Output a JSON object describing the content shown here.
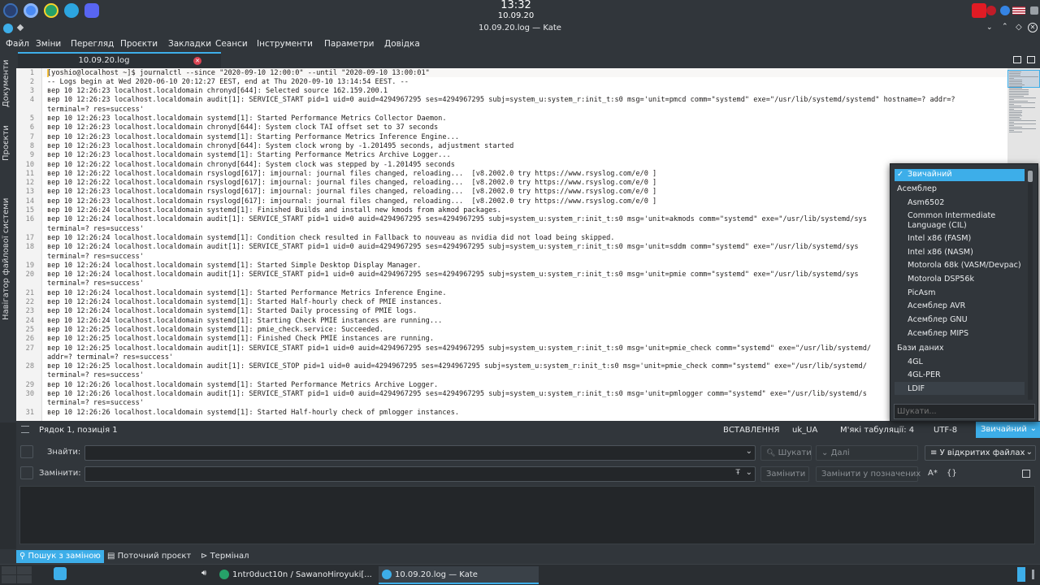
{
  "top_panel": {
    "time": "13:32",
    "date": "10.09.20",
    "launchers": [
      "fedora-icon",
      "chromium-icon",
      "app-icon",
      "telegram-icon",
      "discord-icon"
    ]
  },
  "window": {
    "title": "10.09.20.log — Kate"
  },
  "menu": [
    "Файл",
    "Зміни",
    "Перегляд",
    "Проєкти",
    "Закладки",
    "Сеанси",
    "Інструменти",
    "Параметри",
    "Довідка"
  ],
  "side_tabs": [
    "Документи",
    "Проєкти",
    "Навігатор файлової системи"
  ],
  "tab": {
    "label": "10.09.20.log"
  },
  "editor": {
    "line_numbers": [
      "1",
      "2",
      "3",
      "4",
      "",
      "5",
      "6",
      "7",
      "8",
      "9",
      "10",
      "11",
      "12",
      "13",
      "14",
      "15",
      "16",
      "",
      "17",
      "18",
      "",
      "19",
      "20",
      "",
      "21",
      "22",
      "23",
      "24",
      "25",
      "26",
      "27",
      "",
      "28",
      "",
      "29",
      "30",
      "",
      "31"
    ],
    "lines": [
      "[yoshio@localhost ~]$ journalctl --since \"2020-09-10 12:00:0\" --until \"2020-09-10 13:00:01\"",
      "-- Logs begin at Wed 2020-06-10 20:12:27 EEST, end at Thu 2020-09-10 13:14:54 EEST. --",
      "вер 10 12:26:23 localhost.localdomain chronyd[644]: Selected source 162.159.200.1",
      "вер 10 12:26:23 localhost.localdomain audit[1]: SERVICE_START pid=1 uid=0 auid=4294967295 ses=4294967295 subj=system_u:system_r:init_t:s0 msg='unit=pmcd comm=\"systemd\" exe=\"/usr/lib/systemd/systemd\" hostname=? addr=?",
      "terminal=? res=success'",
      "вер 10 12:26:23 localhost.localdomain systemd[1]: Started Performance Metrics Collector Daemon.",
      "вер 10 12:26:23 localhost.localdomain chronyd[644]: System clock TAI offset set to 37 seconds",
      "вер 10 12:26:23 localhost.localdomain systemd[1]: Starting Performance Metrics Inference Engine...",
      "вер 10 12:26:23 localhost.localdomain chronyd[644]: System clock wrong by -1.201495 seconds, adjustment started",
      "вер 10 12:26:23 localhost.localdomain systemd[1]: Starting Performance Metrics Archive Logger...",
      "вер 10 12:26:22 localhost.localdomain chronyd[644]: System clock was stepped by -1.201495 seconds",
      "вер 10 12:26:22 localhost.localdomain rsyslogd[617]: imjournal: journal files changed, reloading...  [v8.2002.0 try https://www.rsyslog.com/e/0 ]",
      "вер 10 12:26:22 localhost.localdomain rsyslogd[617]: imjournal: journal files changed, reloading...  [v8.2002.0 try https://www.rsyslog.com/e/0 ]",
      "вер 10 12:26:23 localhost.localdomain rsyslogd[617]: imjournal: journal files changed, reloading...  [v8.2002.0 try https://www.rsyslog.com/e/0 ]",
      "вер 10 12:26:23 localhost.localdomain rsyslogd[617]: imjournal: journal files changed, reloading...  [v8.2002.0 try https://www.rsyslog.com/e/0 ]",
      "вер 10 12:26:24 localhost.localdomain systemd[1]: Finished Builds and install new kmods from akmod packages.",
      "вер 10 12:26:24 localhost.localdomain audit[1]: SERVICE_START pid=1 uid=0 auid=4294967295 ses=4294967295 subj=system_u:system_r:init_t:s0 msg='unit=akmods comm=\"systemd\" exe=\"/usr/lib/systemd/sys",
      "terminal=? res=success'",
      "вер 10 12:26:24 localhost.localdomain systemd[1]: Condition check resulted in Fallback to nouveau as nvidia did not load being skipped.",
      "вер 10 12:26:24 localhost.localdomain audit[1]: SERVICE_START pid=1 uid=0 auid=4294967295 ses=4294967295 subj=system_u:system_r:init_t:s0 msg='unit=sddm comm=\"systemd\" exe=\"/usr/lib/systemd/sys",
      "terminal=? res=success'",
      "вер 10 12:26:24 localhost.localdomain systemd[1]: Started Simple Desktop Display Manager.",
      "вер 10 12:26:24 localhost.localdomain audit[1]: SERVICE_START pid=1 uid=0 auid=4294967295 ses=4294967295 subj=system_u:system_r:init_t:s0 msg='unit=pmie comm=\"systemd\" exe=\"/usr/lib/systemd/sys",
      "terminal=? res=success'",
      "вер 10 12:26:24 localhost.localdomain systemd[1]: Started Performance Metrics Inference Engine.",
      "вер 10 12:26:24 localhost.localdomain systemd[1]: Started Half-hourly check of PMIE instances.",
      "вер 10 12:26:24 localhost.localdomain systemd[1]: Started Daily processing of PMIE logs.",
      "вер 10 12:26:24 localhost.localdomain systemd[1]: Starting Check PMIE instances are running...",
      "вер 10 12:26:25 localhost.localdomain systemd[1]: pmie_check.service: Succeeded.",
      "вер 10 12:26:25 localhost.localdomain systemd[1]: Finished Check PMIE instances are running.",
      "вер 10 12:26:25 localhost.localdomain audit[1]: SERVICE_START pid=1 uid=0 auid=4294967295 ses=4294967295 subj=system_u:system_r:init_t:s0 msg='unit=pmie_check comm=\"systemd\" exe=\"/usr/lib/systemd/",
      "addr=? terminal=? res=success'",
      "вер 10 12:26:25 localhost.localdomain audit[1]: SERVICE_STOP pid=1 uid=0 auid=4294967295 ses=4294967295 subj=system_u:system_r:init_t:s0 msg='unit=pmie_check comm=\"systemd\" exe=\"/usr/lib/systemd/",
      "terminal=? res=success'",
      "вер 10 12:26:26 localhost.localdomain systemd[1]: Started Performance Metrics Archive Logger.",
      "вер 10 12:26:26 localhost.localdomain audit[1]: SERVICE_START pid=1 uid=0 auid=4294967295 ses=4294967295 subj=system_u:system_r:init_t:s0 msg='unit=pmlogger comm=\"systemd\" exe=\"/usr/lib/systemd/s",
      "terminal=? res=success'",
      "вер 10 12:26:26 localhost.localdomain systemd[1]: Started Half-hourly check of pmlogger instances."
    ]
  },
  "status_bar": {
    "position": "Рядок 1, позиція 1",
    "insert_mode": "ВСТАВЛЕННЯ",
    "dictionary": "uk_UA",
    "indentation": "М'які табуляції: 4",
    "encoding": "UTF-8",
    "mode": "Звичайний"
  },
  "mode_popup": {
    "selected": "Звичайний",
    "groups": [
      {
        "header": "Асемблер",
        "items": [
          "Asm6502",
          "Common Intermediate",
          "Language (CIL)",
          "Intel x86 (FASM)",
          "Intel x86 (NASM)",
          "Motorola 68k (VASM/Devpac)",
          "Motorola DSP56k",
          "PicAsm",
          "Асемблер AVR",
          "Асемблер GNU",
          "Асемблер MIPS"
        ]
      },
      {
        "header": "Бази даних",
        "items": [
          "4GL",
          "4GL-PER",
          "LDIF"
        ]
      }
    ],
    "search_placeholder": "Шукати..."
  },
  "search_panel": {
    "find_label": "Знайти:",
    "replace_label": "Замінити:",
    "find_value": "",
    "replace_value": "",
    "search_button": "Шукати",
    "next_button": "Далі",
    "scope": "У відкритих файлах",
    "replace_button": "Замінити",
    "replace_checked_button": "Замінити у позначених",
    "case_toggle": "A*",
    "regex_toggle": "{}"
  },
  "tool_tabs": [
    "Пошук з заміною",
    "Поточний проєкт",
    "Термінал"
  ],
  "taskbar": {
    "tasks": [
      "1ntr0duct10n / SawanoHiroyuki[...",
      "10.09.20.log — Kate"
    ]
  }
}
